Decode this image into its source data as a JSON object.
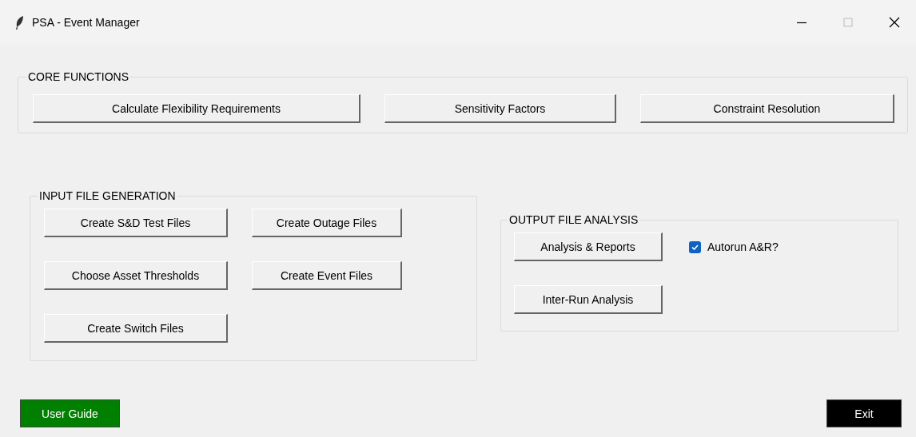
{
  "window": {
    "title": "PSA - Event Manager"
  },
  "core_functions": {
    "title": "CORE FUNCTIONS",
    "buttons": [
      "Calculate Flexibility Requirements",
      "Sensitivity Factors",
      "Constraint Resolution"
    ]
  },
  "input_file_generation": {
    "title": "INPUT FILE GENERATION",
    "buttons": [
      "Create S&D Test Files",
      "Create Outage Files",
      "Choose Asset Thresholds",
      "Create Event Files",
      "Create Switch Files"
    ]
  },
  "output_file_analysis": {
    "title": "OUTPUT FILE ANALYSIS",
    "buttons": [
      "Analysis & Reports",
      "Inter-Run Analysis"
    ],
    "checkbox": {
      "label": "Autorun A&R?",
      "checked": true
    }
  },
  "footer": {
    "buttons": [
      {
        "label": "User Guide",
        "color": "#007f00"
      },
      {
        "label": "Exit",
        "color": "#000000"
      }
    ]
  }
}
